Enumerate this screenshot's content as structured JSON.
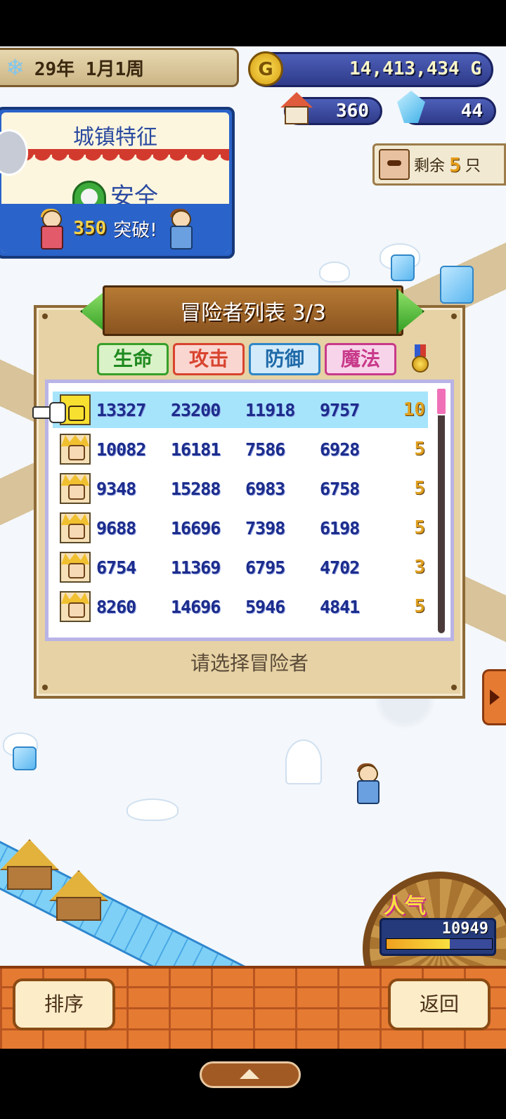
{
  "hud": {
    "year": "29",
    "year_unit": "年",
    "month": "1",
    "month_unit": "月",
    "week": "1",
    "week_unit": "周",
    "gold": "14,413,434",
    "gold_unit": "G",
    "coin_icon": "coin-icon",
    "population": "360",
    "gems": "44"
  },
  "remaining": {
    "label": "剩余",
    "count": "5",
    "unit": "只"
  },
  "town_feature": {
    "title": "城镇特征",
    "status": "安全",
    "break_count": "350",
    "break_label": "突破!"
  },
  "adventurer_list": {
    "title": "冒险者列表 3/3",
    "columns": [
      "生命",
      "攻击",
      "防御",
      "魔法"
    ],
    "rank_icon": "medal-icon",
    "rows": [
      {
        "hp": "13327",
        "atk": "23200",
        "def": "11918",
        "mag": "9757",
        "rank": "10",
        "selected": true
      },
      {
        "hp": "10082",
        "atk": "16181",
        "def": "7586",
        "mag": "6928",
        "rank": "5",
        "selected": false
      },
      {
        "hp": "9348",
        "atk": "15288",
        "def": "6983",
        "mag": "6758",
        "rank": "5",
        "selected": false
      },
      {
        "hp": "9688",
        "atk": "16696",
        "def": "7398",
        "mag": "6198",
        "rank": "5",
        "selected": false
      },
      {
        "hp": "6754",
        "atk": "11369",
        "def": "6795",
        "mag": "4702",
        "rank": "3",
        "selected": false
      },
      {
        "hp": "8260",
        "atk": "14696",
        "def": "5946",
        "mag": "4841",
        "rank": "5",
        "selected": false
      }
    ],
    "hint": "请选择冒险者"
  },
  "popularity": {
    "label": "人气",
    "score": "10949",
    "bar_fraction": 0.6
  },
  "bottom": {
    "sort_label": "排序",
    "back_label": "返回"
  }
}
